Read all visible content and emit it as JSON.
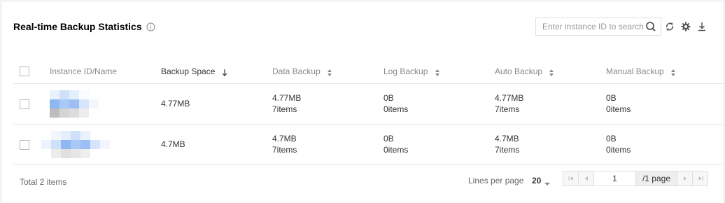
{
  "header": {
    "title": "Real-time Backup Statistics",
    "info_icon": "info-circle-icon"
  },
  "search": {
    "placeholder": "Enter instance ID to search",
    "value": ""
  },
  "toolbar": {
    "icons": [
      "refresh-icon",
      "settings-icon",
      "download-icon"
    ]
  },
  "table": {
    "columns": {
      "name": "Instance ID/Name",
      "backup_space": "Backup Space",
      "data_backup": "Data Backup",
      "log_backup": "Log Backup",
      "auto_backup": "Auto Backup",
      "manual_backup": "Manual Backup"
    },
    "sorted_column": "backup_space",
    "sort_direction": "desc",
    "rows": [
      {
        "backup_space": "4.77MB",
        "data_size": "4.77MB",
        "data_count": "7items",
        "log_size": "0B",
        "log_count": "0items",
        "auto_size": "4.77MB",
        "auto_count": "7items",
        "manual_size": "0B",
        "manual_count": "0items"
      },
      {
        "backup_space": "4.7MB",
        "data_size": "4.7MB",
        "data_count": "7items",
        "log_size": "0B",
        "log_count": "0items",
        "auto_size": "4.7MB",
        "auto_count": "7items",
        "manual_size": "0B",
        "manual_count": "0items"
      }
    ]
  },
  "footer": {
    "total": "Total 2 items",
    "lines_per_page_label": "Lines per page",
    "lines_per_page_value": "20",
    "current_page": "1",
    "page_total": "/1 page"
  },
  "colors": {
    "border": "#e5e5e5",
    "header_text": "#888888",
    "redacted_blue": "#a9c8f5",
    "redacted_gray": "#d9d9d9"
  }
}
